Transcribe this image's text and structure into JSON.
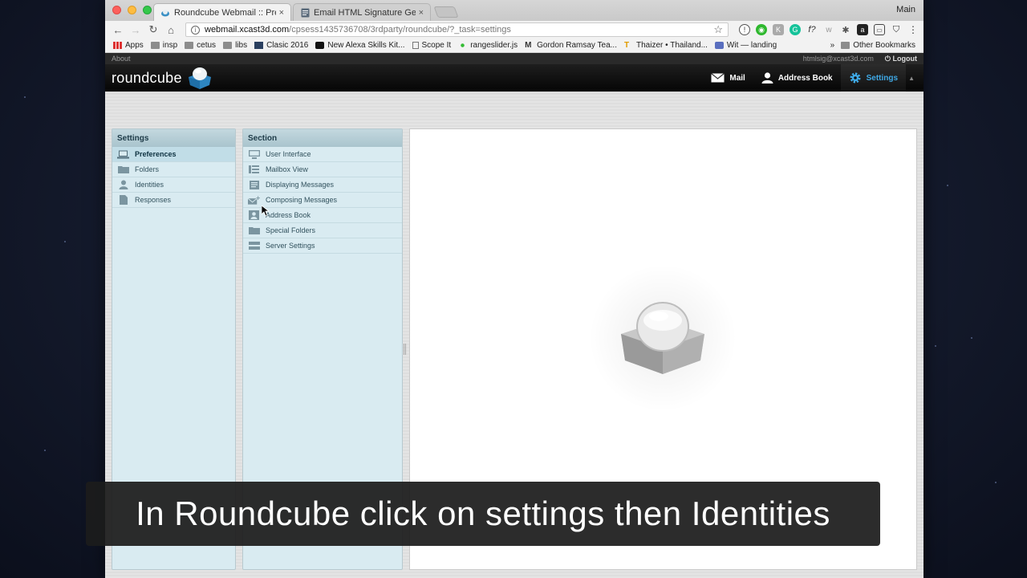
{
  "desktop": {
    "menu_label": "Main"
  },
  "browser": {
    "tabs": [
      {
        "title": "Roundcube Webmail :: Preferen",
        "close": "×",
        "active": true
      },
      {
        "title": "Email HTML Signature Generat",
        "close": "×",
        "active": false
      }
    ],
    "url_host": "webmail.xcast3d.com",
    "url_path": "/cpsess1435736708/3rdparty/roundcube/?_task=settings",
    "bookmarks": [
      {
        "label": "Apps",
        "icon": "apps-grid-icon"
      },
      {
        "label": "insp",
        "icon": "folder-icon"
      },
      {
        "label": "cetus",
        "icon": "folder-icon"
      },
      {
        "label": "libs",
        "icon": "folder-icon"
      },
      {
        "label": "Clasic 2016",
        "icon": "book-icon"
      },
      {
        "label": "New Alexa Skills Kit...",
        "icon": "amazon-icon"
      },
      {
        "label": "Scope It",
        "icon": "page-icon"
      },
      {
        "label": "rangeslider.js",
        "icon": "dots-icon"
      },
      {
        "label": "Gordon Ramsay Tea...",
        "icon": "medium-icon"
      },
      {
        "label": "Thaizer • Thailand...",
        "icon": "thaizer-icon"
      },
      {
        "label": "Wit — landing",
        "icon": "wit-icon"
      }
    ],
    "bookmarks_more": "»",
    "other_bookmarks": "Other Bookmarks"
  },
  "roundcube": {
    "about": "About",
    "user_email": "htmlsig@xcast3d.com",
    "logout": "Logout",
    "logo_text": "roundcube",
    "nav": [
      {
        "label": "Mail",
        "icon": "envelope-icon",
        "selected": false
      },
      {
        "label": "Address Book",
        "icon": "person-icon",
        "selected": false
      },
      {
        "label": "Settings",
        "icon": "gear-icon",
        "selected": true
      }
    ],
    "settings_panel": {
      "header": "Settings",
      "items": [
        {
          "label": "Preferences",
          "icon": "laptop-icon",
          "selected": true
        },
        {
          "label": "Folders",
          "icon": "folder-icon",
          "selected": false
        },
        {
          "label": "Identities",
          "icon": "person-icon",
          "selected": false
        },
        {
          "label": "Responses",
          "icon": "document-icon",
          "selected": false
        }
      ]
    },
    "section_panel": {
      "header": "Section",
      "items": [
        {
          "label": "User Interface",
          "icon": "monitor-icon"
        },
        {
          "label": "Mailbox View",
          "icon": "list-icon"
        },
        {
          "label": "Displaying Messages",
          "icon": "message-icon"
        },
        {
          "label": "Composing Messages",
          "icon": "compose-icon"
        },
        {
          "label": "Address Book",
          "icon": "contact-card-icon"
        },
        {
          "label": "Special Folders",
          "icon": "folder-icon"
        },
        {
          "label": "Server Settings",
          "icon": "server-icon"
        }
      ]
    }
  },
  "caption": "In Roundcube click on settings then Identities",
  "colors": {
    "accent": "#3fa9e6",
    "panel_bg": "#d9ebf1",
    "header_bg": "#050505"
  }
}
